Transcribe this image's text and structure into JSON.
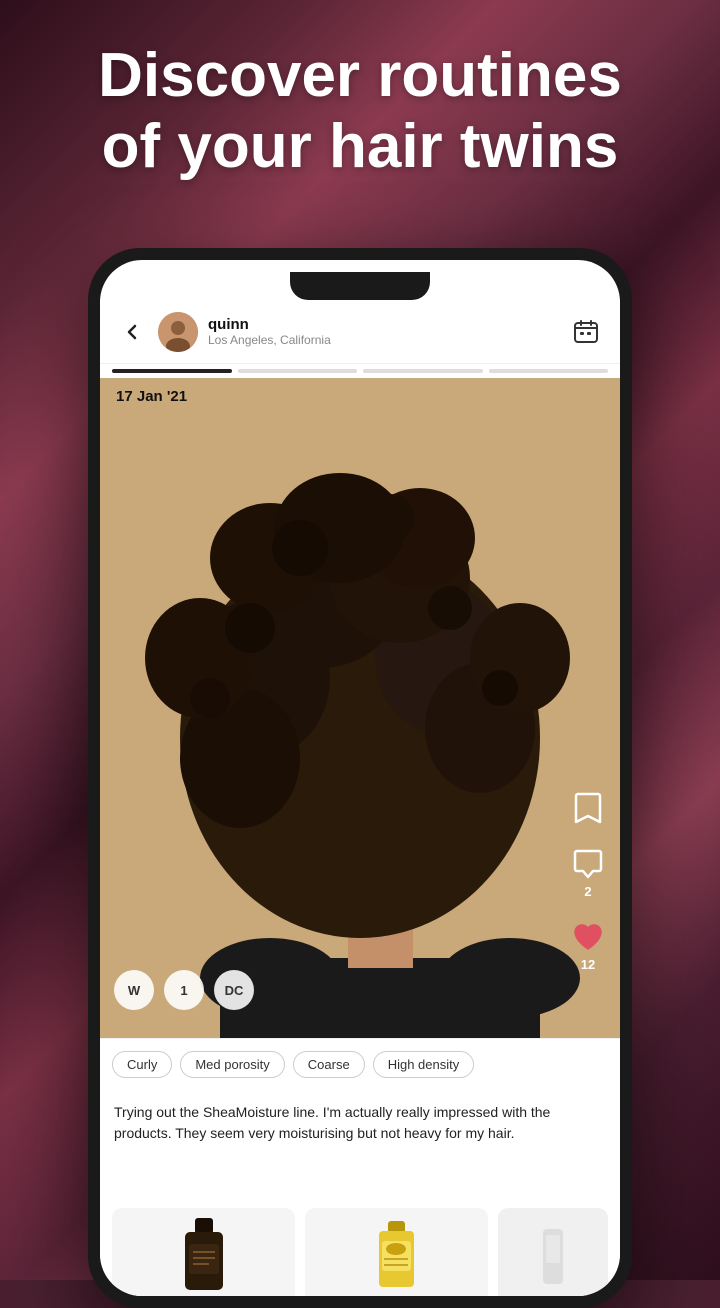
{
  "headline": {
    "line1": "Discover routines",
    "line2": "of your hair twins"
  },
  "phone": {
    "header": {
      "back_label": "←",
      "username": "quinn",
      "location": "Los Angeles, California",
      "calendar_icon": "calendar"
    },
    "progress": {
      "bars": [
        {
          "active": true
        },
        {
          "active": false
        },
        {
          "active": false
        },
        {
          "active": false
        }
      ]
    },
    "date": "17 Jan '21",
    "actions": {
      "bookmark_icon": "bookmark",
      "comment_icon": "comment",
      "comment_count": "2",
      "heart_icon": "heart",
      "heart_count": "12"
    },
    "badges": [
      {
        "label": "W"
      },
      {
        "label": "1"
      },
      {
        "label": "DC"
      }
    ],
    "hair_tags": [
      "Curly",
      "Med porosity",
      "Coarse",
      "High density"
    ],
    "description": "Trying out the SheaMoisture line. I'm actually really impressed with the products. They seem very moisturising but not heavy for my hair.",
    "products": [
      {
        "type": "dark_bottle"
      },
      {
        "type": "light_bottle"
      }
    ]
  }
}
